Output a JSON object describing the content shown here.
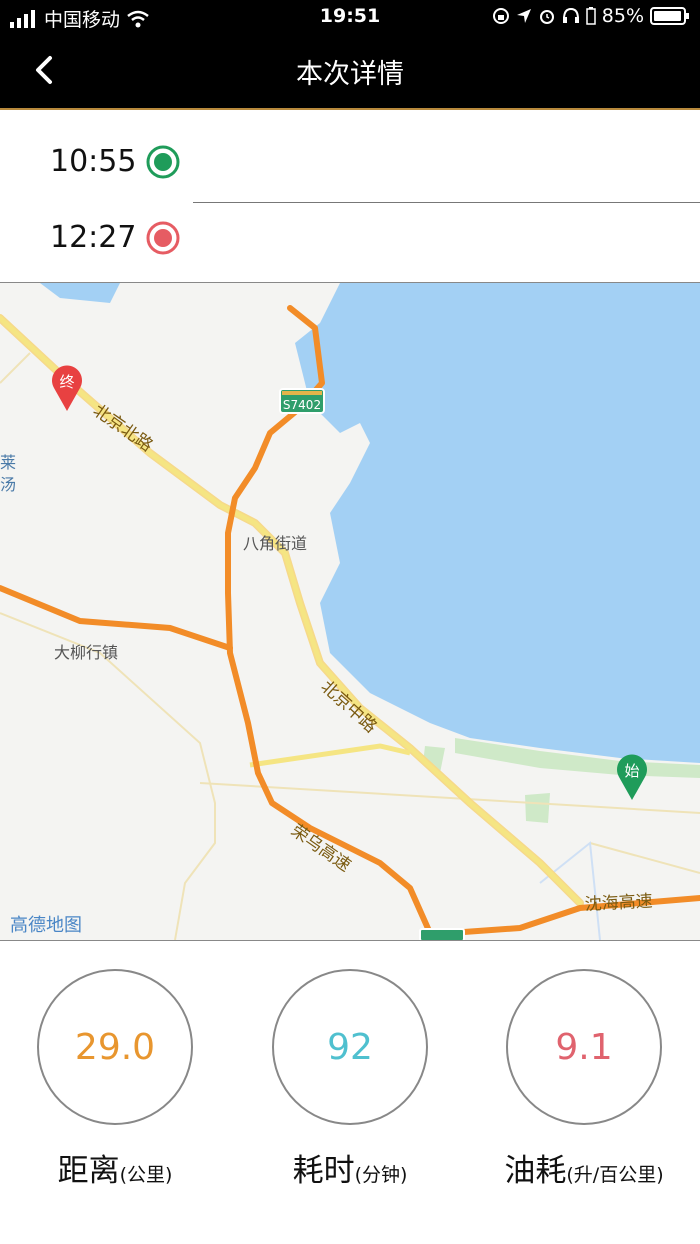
{
  "status": {
    "carrier": "中国移动",
    "time": "19:51",
    "battery": "85%"
  },
  "nav": {
    "title": "本次详情"
  },
  "trip": {
    "start_time": "10:55",
    "end_time": "12:27"
  },
  "map": {
    "labels": {
      "beijing_n": "北京北路",
      "bajiao": "八角街道",
      "daliu": "大柳行镇",
      "beijing_m": "北京中路",
      "rongwu": "荣乌高速",
      "shenhai": "沈海高速",
      "lai1": "莱",
      "lai2": "汤",
      "amap": "高德地图",
      "s7402": "S7402"
    },
    "markers": {
      "end": "终",
      "start": "始"
    }
  },
  "stats": {
    "distance": {
      "value": "29.0",
      "label": "距离",
      "unit": "(公里)",
      "color": "#e8962f"
    },
    "duration": {
      "value": "92",
      "label": "耗时",
      "unit": "(分钟)",
      "color": "#4fc0cf"
    },
    "fuel": {
      "value": "9.1",
      "label": "油耗",
      "unit": "(升/百公里)",
      "color": "#e0636e"
    }
  }
}
